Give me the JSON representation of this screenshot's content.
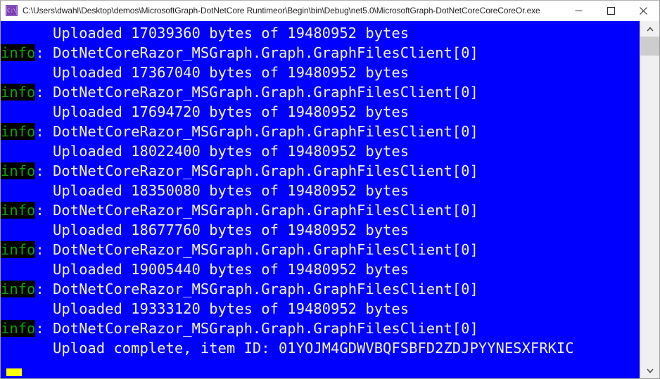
{
  "window": {
    "title": "C:\\Users\\dwahl\\Desktop\\demos\\MicrosoftGraph-DotNetCore Runtimeor\\Begin\\bin\\Debug\\net5.0\\MicrosoftGraph-DotNetCoreCoreCoreOr.exe",
    "icon_label": "C:\\",
    "icon_name": "console-app-icon",
    "background_color": "#0000ff",
    "foreground_color": "#f2f2f2",
    "controls": {
      "minimize_label": "—",
      "maximize_label": "□",
      "close_label": "✕"
    }
  },
  "console": {
    "log_level_label": "info",
    "log_level_color": "#13a10e",
    "log_level_background": "#000000",
    "separator": ":",
    "logger_name": "DotNetCoreRazor_MSGraph.Graph.GraphFilesClient[0]",
    "indent": "      ",
    "total_bytes": "19480952",
    "item_id": "01YOJM4GDWVBQFSBFD2ZDJPYYNESXFRKIC",
    "cursor_color": "#ffff00",
    "lines": [
      {
        "type": "message",
        "text": "      Uploaded 17039360 bytes of 19480952 bytes"
      },
      {
        "type": "header",
        "text": "DotNetCoreRazor_MSGraph.Graph.GraphFilesClient[0]"
      },
      {
        "type": "message",
        "text": "      Uploaded 17367040 bytes of 19480952 bytes"
      },
      {
        "type": "header",
        "text": "DotNetCoreRazor_MSGraph.Graph.GraphFilesClient[0]"
      },
      {
        "type": "message",
        "text": "      Uploaded 17694720 bytes of 19480952 bytes"
      },
      {
        "type": "header",
        "text": "DotNetCoreRazor_MSGraph.Graph.GraphFilesClient[0]"
      },
      {
        "type": "message",
        "text": "      Uploaded 18022400 bytes of 19480952 bytes"
      },
      {
        "type": "header",
        "text": "DotNetCoreRazor_MSGraph.Graph.GraphFilesClient[0]"
      },
      {
        "type": "message",
        "text": "      Uploaded 18350080 bytes of 19480952 bytes"
      },
      {
        "type": "header",
        "text": "DotNetCoreRazor_MSGraph.Graph.GraphFilesClient[0]"
      },
      {
        "type": "message",
        "text": "      Uploaded 18677760 bytes of 19480952 bytes"
      },
      {
        "type": "header",
        "text": "DotNetCoreRazor_MSGraph.Graph.GraphFilesClient[0]"
      },
      {
        "type": "message",
        "text": "      Uploaded 19005440 bytes of 19480952 bytes"
      },
      {
        "type": "header",
        "text": "DotNetCoreRazor_MSGraph.Graph.GraphFilesClient[0]"
      },
      {
        "type": "message",
        "text": "      Uploaded 19333120 bytes of 19480952 bytes"
      },
      {
        "type": "header",
        "text": "DotNetCoreRazor_MSGraph.Graph.GraphFilesClient[0]"
      },
      {
        "type": "message",
        "text": "      Upload complete, item ID: 01YOJM4GDWVBQFSBFD2ZDJPYYNESXFRKIC"
      }
    ]
  },
  "scrollbar": {
    "up_arrow": "⌃",
    "down_arrow": "⌄"
  }
}
